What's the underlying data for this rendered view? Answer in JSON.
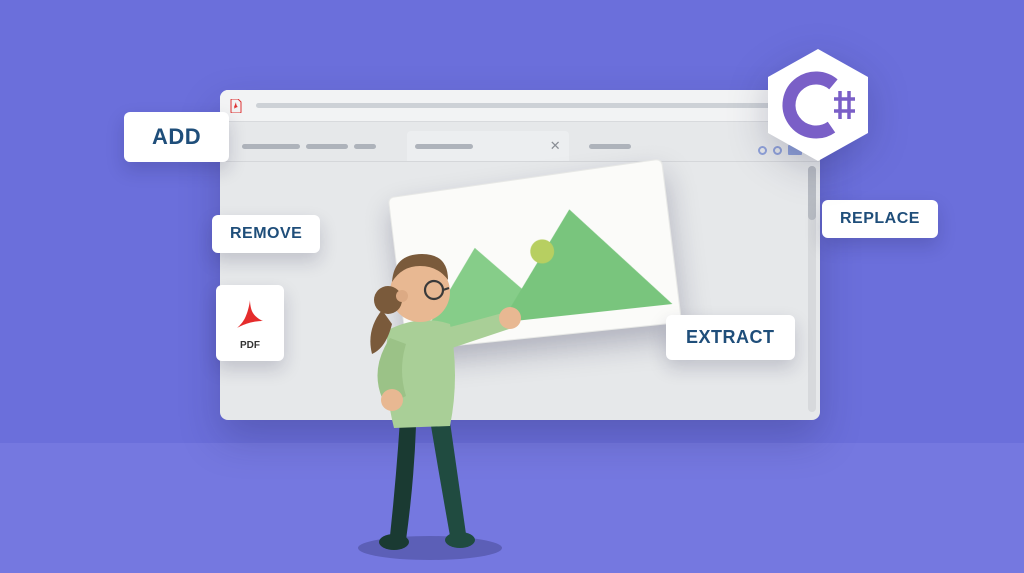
{
  "labels": {
    "add": "ADD",
    "remove": "REMOVE",
    "replace": "REPLACE",
    "extract": "EXTRACT"
  },
  "pdf_badge": "PDF",
  "csharp": "C#",
  "icons": {
    "pdf": "pdf-icon",
    "image": "image-placeholder-icon",
    "csharp": "csharp-hex-icon"
  },
  "colors": {
    "background": "#6b6fdb",
    "floor": "#7578e0",
    "label_text": "#1f4e7a",
    "mountain": "#79c57d",
    "csharp_purple": "#7a5fc7"
  }
}
